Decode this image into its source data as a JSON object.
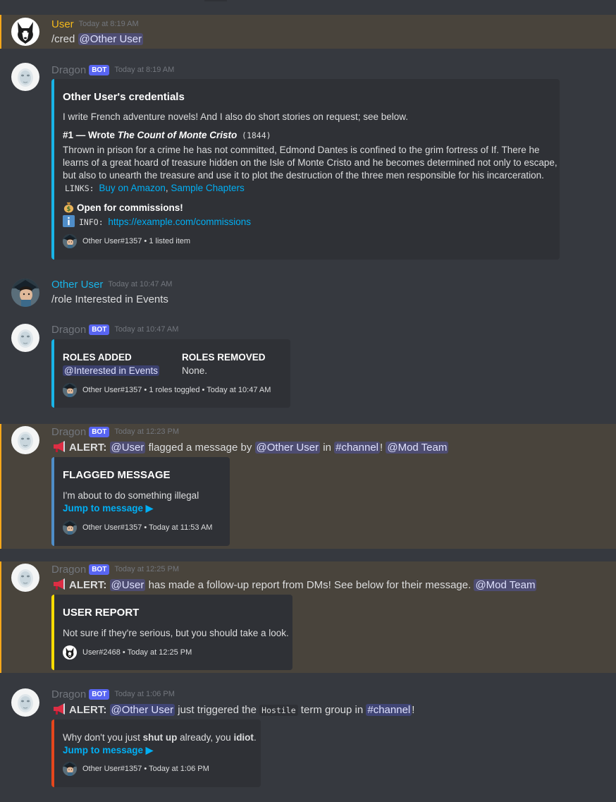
{
  "m1": {
    "author": "User",
    "time": "Today at 8:19 AM",
    "cmd": "/cred",
    "mention": "@Other User"
  },
  "m2": {
    "author": "Dragon",
    "bot": "BOT",
    "time": "Today at 8:19 AM",
    "title": "Other User's credentials",
    "desc": "I write French adventure novels! And I also do short stories on request; see below.",
    "item_prefix": "#1 — Wrote ",
    "item_title": "The Count of Monte Cristo",
    "item_year": "(1844)",
    "item_desc_1": "Thrown in prison for a crime he has not committed, Edmond Dantes is confined to the grim fortress of If. There he",
    "item_desc_2": "learns of a great hoard of treasure hidden on the Isle of Monte Cristo and he becomes determined not only to escape,",
    "item_desc_3": "but also to unearth the treasure and use it to plot the destruction of the three men responsible for his incarceration.",
    "links_label": "LINKS:",
    "link1": "Buy on Amazon",
    "link_sep": ", ",
    "link2": "Sample Chapters",
    "commission": "Open for commissions!",
    "info_label": "INFO:",
    "info_link": "https://example.com/commissions",
    "footer": "Other User#1357 • 1 listed item"
  },
  "m3": {
    "author": "Other User",
    "time": "Today at 10:47 AM",
    "text": "/role Interested in Events"
  },
  "m4": {
    "author": "Dragon",
    "bot": "BOT",
    "time": "Today at 10:47 AM",
    "added_title": "ROLES ADDED",
    "added_value": "@Interested in Events",
    "removed_title": "ROLES REMOVED",
    "removed_value": "None.",
    "footer": "Other User#1357 • 1 roles toggled • Today at 10:47 AM"
  },
  "m5": {
    "author": "Dragon",
    "bot": "BOT",
    "time": "Today at 12:23 PM",
    "alert": "ALERT:",
    "m_user": "@User",
    "t1": " flagged a message by ",
    "m_other": "@Other User",
    "t2": " in ",
    "m_channel": "#channel",
    "t3": "! ",
    "m_mod": "@Mod Team",
    "title": "FLAGGED MESSAGE",
    "desc": "I'm about to do something illegal",
    "jump": "Jump to message ▶",
    "footer": "Other User#1357 • Today at 11:53 AM"
  },
  "m6": {
    "author": "Dragon",
    "bot": "BOT",
    "time": "Today at 12:25 PM",
    "alert": "ALERT:",
    "m_user": "@User",
    "t1": " has made a follow-up report from DMs! See below for their message. ",
    "m_mod": "@Mod Team",
    "title": "USER REPORT",
    "desc": "Not sure if they're serious, but you should take a look.",
    "footer": "User#2468 • Today at 12:25 PM"
  },
  "m7": {
    "author": "Dragon",
    "bot": "BOT",
    "time": "Today at 1:06 PM",
    "alert": "ALERT:",
    "m_other": "@Other User",
    "t1": " just triggered the ",
    "code": "Hostile",
    "t2": " term group in ",
    "m_channel": "#channel",
    "t3": "!",
    "d1": "Why don't you just ",
    "d_b1": "shut up",
    "d2": " already, you ",
    "d_b2": "idiot",
    "d3": ".",
    "jump": "Jump to message ▶",
    "footer": "Other User#1357 • Today at 1:06 PM"
  },
  "colors": {
    "bg": "#36393f",
    "embed_bg": "#2f3136",
    "highlight": "#49443c",
    "mention": "#5865f2",
    "link": "#00aff4",
    "blue": "#19b4e7",
    "gold": "#f4b91b",
    "red": "#e5461c",
    "yellow": "#fedc00",
    "grey_blue": "#4f8dc8"
  },
  "icons": [
    "husky-avatar",
    "dragon-avatar",
    "other-user-avatar",
    "money-bag-icon",
    "info-icon",
    "megaphone-icon"
  ]
}
